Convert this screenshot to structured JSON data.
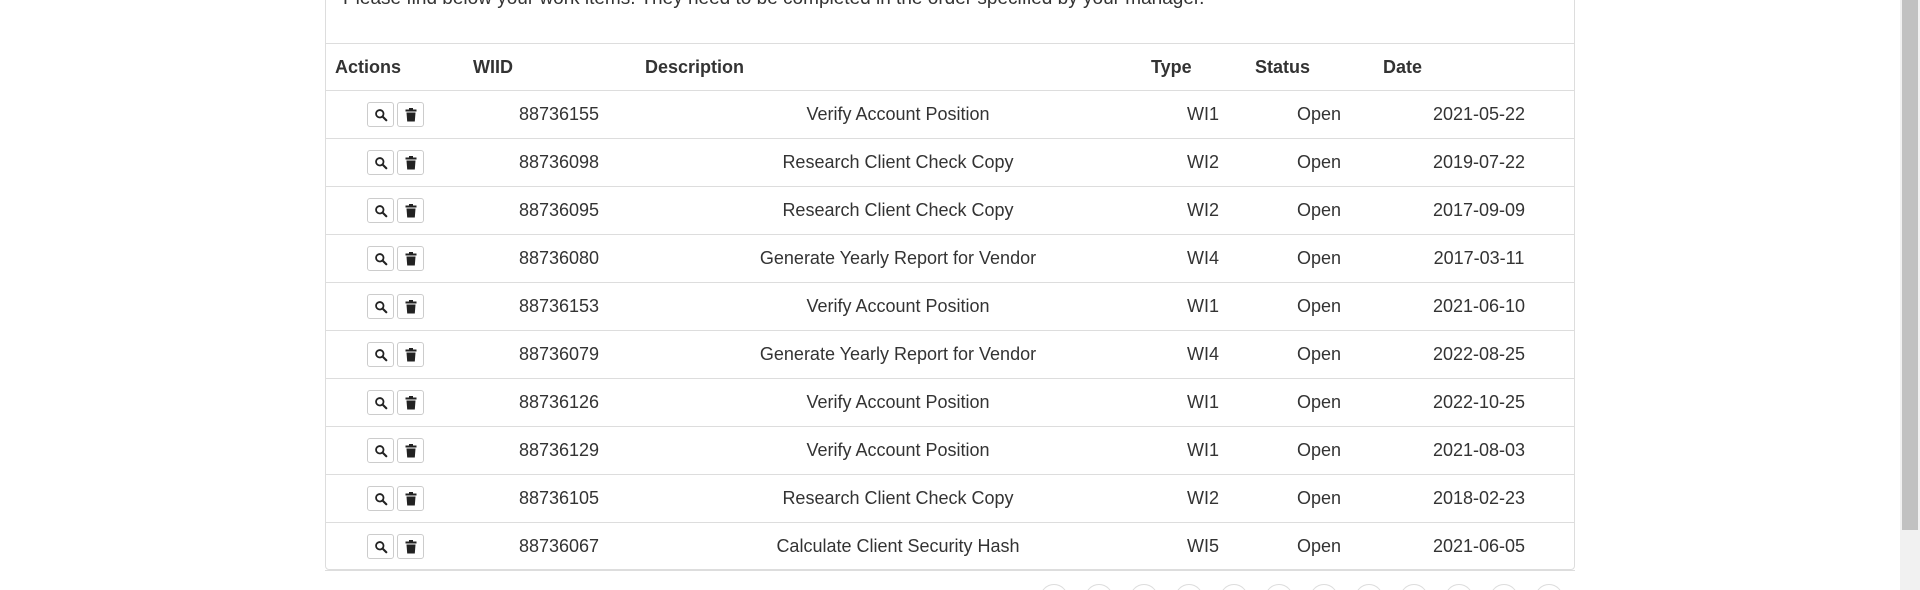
{
  "intro_text": "Please find below your work items. They need to be completed in the order specified by your manager.",
  "table": {
    "headers": {
      "actions": "Actions",
      "wiid": "WIID",
      "description": "Description",
      "type": "Type",
      "status": "Status",
      "date": "Date"
    },
    "rows": [
      {
        "wiid": "88736155",
        "description": "Verify Account Position",
        "type": "WI1",
        "status": "Open",
        "date": "2021-05-22"
      },
      {
        "wiid": "88736098",
        "description": "Research Client Check Copy",
        "type": "WI2",
        "status": "Open",
        "date": "2019-07-22"
      },
      {
        "wiid": "88736095",
        "description": "Research Client Check Copy",
        "type": "WI2",
        "status": "Open",
        "date": "2017-09-09"
      },
      {
        "wiid": "88736080",
        "description": "Generate Yearly Report for Vendor",
        "type": "WI4",
        "status": "Open",
        "date": "2017-03-11"
      },
      {
        "wiid": "88736153",
        "description": "Verify Account Position",
        "type": "WI1",
        "status": "Open",
        "date": "2021-06-10"
      },
      {
        "wiid": "88736079",
        "description": "Generate Yearly Report for Vendor",
        "type": "WI4",
        "status": "Open",
        "date": "2022-08-25"
      },
      {
        "wiid": "88736126",
        "description": "Verify Account Position",
        "type": "WI1",
        "status": "Open",
        "date": "2022-10-25"
      },
      {
        "wiid": "88736129",
        "description": "Verify Account Position",
        "type": "WI1",
        "status": "Open",
        "date": "2021-08-03"
      },
      {
        "wiid": "88736105",
        "description": "Research Client Check Copy",
        "type": "WI2",
        "status": "Open",
        "date": "2018-02-23"
      },
      {
        "wiid": "88736067",
        "description": "Calculate Client Security Hash",
        "type": "WI5",
        "status": "Open",
        "date": "2021-06-05"
      }
    ]
  },
  "icons": {
    "view": "search-icon",
    "delete": "trash-icon"
  },
  "colors": {
    "text": "#333333",
    "border": "#dddddd",
    "icon": "#222222"
  }
}
